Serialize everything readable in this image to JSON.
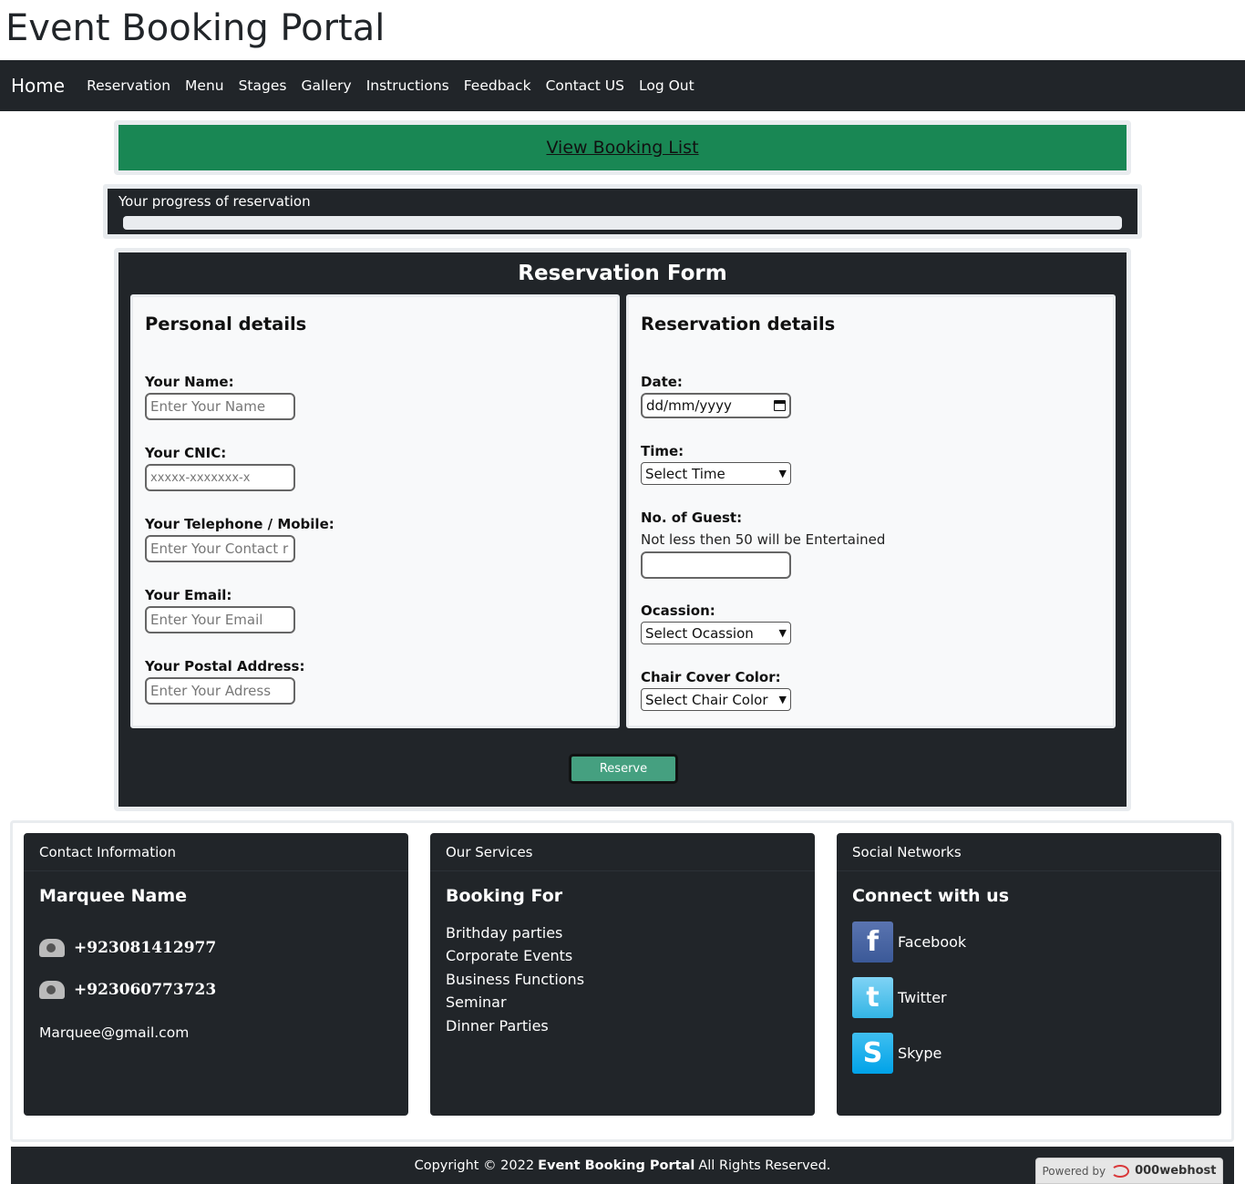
{
  "site": {
    "title": "Event Booking Portal"
  },
  "nav": {
    "brand": "Home",
    "links": [
      "Reservation",
      "Menu",
      "Stages",
      "Gallery",
      "Instructions",
      "Feedback",
      "Contact US",
      "Log Out"
    ]
  },
  "booking": {
    "view_list": "View Booking List"
  },
  "progress": {
    "label": "Your progress of reservation",
    "value_percent": 0
  },
  "form": {
    "title": "Reservation Form",
    "personal": {
      "title": "Personal details",
      "name_label": "Your Name:",
      "name_placeholder": "Enter Your Name",
      "cnic_label": "Your CNIC:",
      "cnic_placeholder": "xxxxx-xxxxxxx-x",
      "phone_label": "Your Telephone / Mobile:",
      "phone_placeholder": "Enter Your Contact r",
      "email_label": "Your Email:",
      "email_placeholder": "Enter Your Email",
      "address_label": "Your Postal Address:",
      "address_placeholder": "Enter Your Adress"
    },
    "reservation": {
      "title": "Reservation details",
      "date_label": "Date:",
      "date_value": "dd/mm/yyyy",
      "time_label": "Time:",
      "time_selected": "Select Time",
      "guest_label": "No. of Guest:",
      "guest_note": "Not less then 50 will be Entertained",
      "guest_value": "",
      "occasion_label": "Ocassion:",
      "occasion_selected": "Select Ocassion",
      "chair_label": "Chair Cover Color:",
      "chair_selected": "Select Chair Color"
    },
    "reserve_button": "Reserve"
  },
  "footer": {
    "contact": {
      "header": "Contact Information",
      "name": "Marquee Name",
      "phones": [
        "+923081412977",
        "+923060773723"
      ],
      "email": "Marquee@gmail.com"
    },
    "services": {
      "header": "Our Services",
      "title": "Booking For",
      "items": [
        "Brithday parties",
        "Corporate Events",
        "Business Functions",
        "Seminar",
        "Dinner Parties"
      ]
    },
    "social": {
      "header": "Social Networks",
      "title": "Connect with us",
      "links": [
        "Facebook",
        "Twitter",
        "Skype"
      ],
      "icons": [
        "facebook-icon",
        "twitter-icon",
        "skype-icon"
      ]
    }
  },
  "copyright": {
    "prefix": "Copyright © 2022",
    "brand": "Event Booking Portal",
    "suffix": "All Rights Reserved."
  },
  "powered": {
    "label": "Powered by",
    "brand": "000webhost"
  },
  "colors": {
    "nav_bg": "#212529",
    "accent_green": "#198754",
    "reserve_btn": "#45a080",
    "panel_light": "#f8f9fa"
  }
}
